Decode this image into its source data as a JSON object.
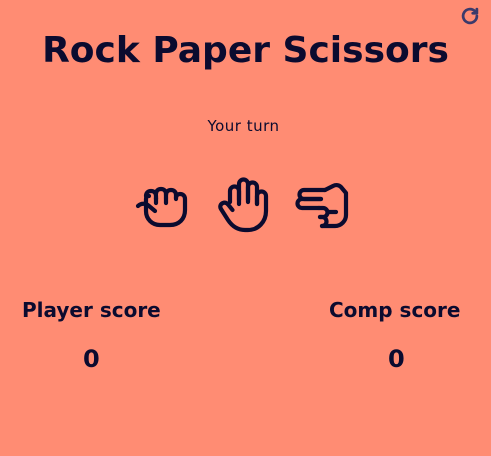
{
  "title": "Rock Paper Scissors",
  "status_text": "Your turn",
  "choices": [
    {
      "name": "rock",
      "icon": "hand-rock-icon"
    },
    {
      "name": "paper",
      "icon": "hand-paper-icon"
    },
    {
      "name": "scissors",
      "icon": "hand-scissors-icon"
    }
  ],
  "reset": {
    "icon": "redo-icon"
  },
  "scores": {
    "player_label": "Player score",
    "player_value": "0",
    "comp_label": "Comp score",
    "comp_value": "0"
  },
  "colors": {
    "background": "#ff8c73",
    "text": "#0b0b2f",
    "reset_icon": "#3b3a6b"
  }
}
